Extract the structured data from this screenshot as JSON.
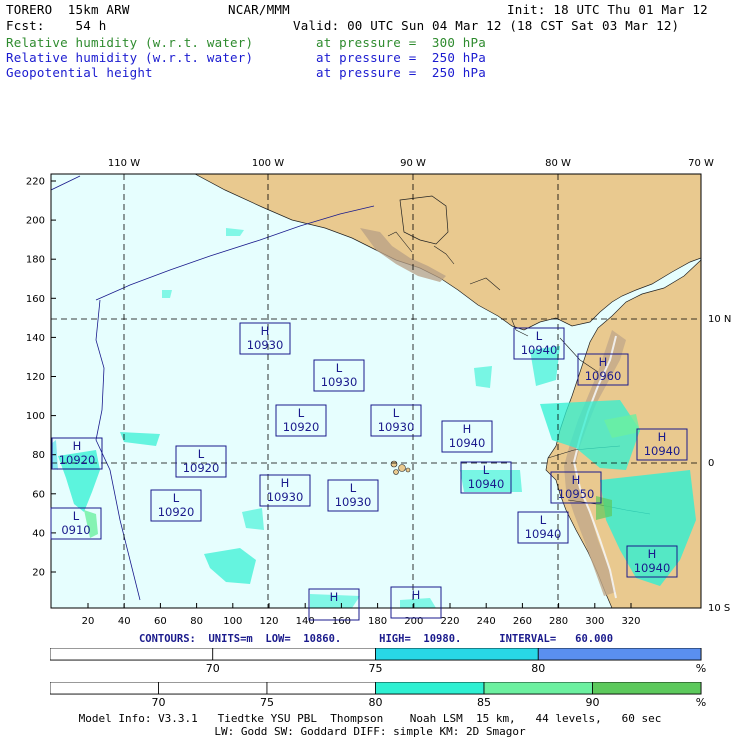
{
  "header": {
    "line1_left": "TORERO  15km ARW",
    "line1_mid": "NCAR/MMM",
    "line1_right": "Init: 18 UTC Thu 01 Mar 12",
    "line2_left": "Fcst:    54 h",
    "line2_right": "Valid: 00 UTC Sun 04 Mar 12 (18 CST Sat 03 Mar 12)",
    "fields": [
      {
        "name": "Relative humidity (w.r.t. water)",
        "level": "at pressure =  300 hPa",
        "color": "#2e8b2e"
      },
      {
        "name": "Relative humidity (w.r.t. water)",
        "level": "at pressure =  250 hPa",
        "color": "#1b1bd0"
      },
      {
        "name": "Geopotential height",
        "level": "at pressure =  250 hPa",
        "color": "#1b1bd0"
      }
    ]
  },
  "map": {
    "top_lon_labels": [
      "110 W",
      "100 W",
      "90 W",
      "80 W",
      "70 W"
    ],
    "right_lat_labels": [
      "10 N",
      "0",
      "10 S"
    ],
    "y_ticks": [
      "220",
      "200",
      "180",
      "160",
      "140",
      "120",
      "100",
      "80",
      "60",
      "40",
      "20"
    ],
    "x_ticks": [
      "20",
      "40",
      "60",
      "80",
      "100",
      "120",
      "140",
      "160",
      "180",
      "200",
      "220",
      "240",
      "260",
      "280",
      "300",
      "320"
    ],
    "ocean_color": "#e6fefe",
    "land_color": "#e9c98f",
    "pressure_centers": [
      {
        "type": "H",
        "value": "10930"
      },
      {
        "type": "L",
        "value": "10930"
      },
      {
        "type": "L",
        "value": "10920"
      },
      {
        "type": "L",
        "value": "10930"
      },
      {
        "type": "H",
        "value": "10940"
      },
      {
        "type": "H",
        "value": "10920"
      },
      {
        "type": "L",
        "value": "10920"
      },
      {
        "type": "L",
        "value": "10920"
      },
      {
        "type": "L",
        "value": "0910"
      },
      {
        "type": "H",
        "value": "10930"
      },
      {
        "type": "L",
        "value": "10930"
      },
      {
        "type": "L",
        "value": "10940"
      },
      {
        "type": "H",
        "value": "10950"
      },
      {
        "type": "L",
        "value": "10940"
      },
      {
        "type": "L",
        "value": "10940"
      },
      {
        "type": "H",
        "value": "10940"
      },
      {
        "type": "H",
        "value": "10960"
      },
      {
        "type": "H",
        "value": "10940"
      },
      {
        "type": "H",
        "value": ""
      },
      {
        "type": "H",
        "value": ""
      }
    ]
  },
  "contours_line": "CONTOURS:  UNITS=m  LOW=  10860.      HIGH=  10980.      INTERVAL=   60.000",
  "colorbar_250": {
    "labels": [
      "70",
      "75",
      "80"
    ],
    "unit": "%",
    "colors": [
      "#ffffff",
      "#ffffff",
      "#28d7e6",
      "#5a8ff0"
    ]
  },
  "colorbar_300": {
    "labels": [
      "70",
      "75",
      "80",
      "85",
      "90"
    ],
    "unit": "%",
    "colors": [
      "#ffffff",
      "#ffffff",
      "#ffffff",
      "#2ef0d2",
      "#6cf0a0",
      "#5cc95c",
      "#2a9a2a"
    ]
  },
  "footer": {
    "line1": "Model Info: V3.3.1   Tiedtke YSU PBL  Thompson    Noah LSM  15 km,   44 levels,   60 sec",
    "line2": "LW: Godd SW: Goddard DIFF: simple KM: 2D Smagor"
  }
}
